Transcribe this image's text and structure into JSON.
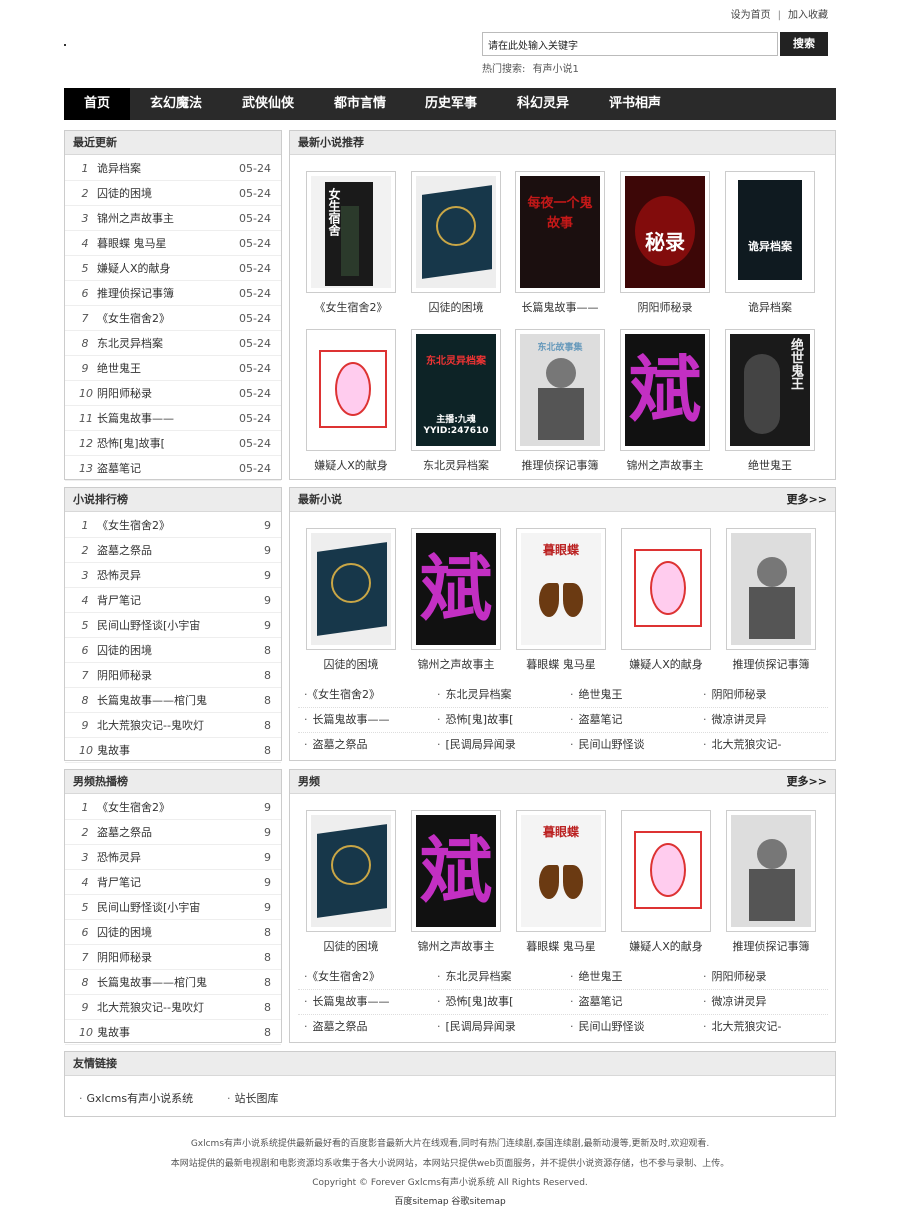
{
  "top_links": {
    "set_home": "设为首页",
    "separator": "|",
    "favorite": "加入收藏"
  },
  "search": {
    "value": "请在此处输入关键字",
    "button": "搜索",
    "hot_label": "热门搜索:",
    "hot_term": "有声小说1"
  },
  "nav": [
    "首页",
    "玄幻魔法",
    "武侠仙侠",
    "都市言情",
    "历史军事",
    "科幻灵异",
    "评书相声"
  ],
  "recent": {
    "title": "最近更新",
    "items": [
      {
        "n": "1",
        "t": "诡异档案",
        "d": "05-24"
      },
      {
        "n": "2",
        "t": "囚徒的困境",
        "d": "05-24"
      },
      {
        "n": "3",
        "t": "锦州之声故事主",
        "d": "05-24"
      },
      {
        "n": "4",
        "t": "暮眼蝶 鬼马星",
        "d": "05-24"
      },
      {
        "n": "5",
        "t": "嫌疑人X的献身",
        "d": "05-24"
      },
      {
        "n": "6",
        "t": "推理侦探记事簿",
        "d": "05-24"
      },
      {
        "n": "7",
        "t": "《女生宿舍2》",
        "d": "05-24"
      },
      {
        "n": "8",
        "t": "东北灵异档案",
        "d": "05-24"
      },
      {
        "n": "9",
        "t": "绝世鬼王",
        "d": "05-24"
      },
      {
        "n": "10",
        "t": "阴阳师秘录",
        "d": "05-24"
      },
      {
        "n": "11",
        "t": "长篇鬼故事——",
        "d": "05-24"
      },
      {
        "n": "12",
        "t": "恐怖[鬼]故事[",
        "d": "05-24"
      },
      {
        "n": "13",
        "t": "盗墓笔记",
        "d": "05-24"
      }
    ]
  },
  "rank": {
    "title": "小说排行榜",
    "items": [
      {
        "n": "1",
        "t": "《女生宿舍2》",
        "s": "9"
      },
      {
        "n": "2",
        "t": "盗墓之祭品",
        "s": "9"
      },
      {
        "n": "3",
        "t": "恐怖灵异",
        "s": "9"
      },
      {
        "n": "4",
        "t": "背尸笔记",
        "s": "9"
      },
      {
        "n": "5",
        "t": "民间山野怪谈[小宇宙",
        "s": "9"
      },
      {
        "n": "6",
        "t": "囚徒的困境",
        "s": "8"
      },
      {
        "n": "7",
        "t": "阴阳师秘录",
        "s": "8"
      },
      {
        "n": "8",
        "t": "长篇鬼故事——棺门鬼",
        "s": "8"
      },
      {
        "n": "9",
        "t": "北大荒狼灾记--鬼吹灯",
        "s": "8"
      },
      {
        "n": "10",
        "t": "鬼故事",
        "s": "8"
      }
    ]
  },
  "male_rank": {
    "title": "男频热播榜",
    "items": [
      {
        "n": "1",
        "t": "《女生宿舍2》",
        "s": "9"
      },
      {
        "n": "2",
        "t": "盗墓之祭品",
        "s": "9"
      },
      {
        "n": "3",
        "t": "恐怖灵异",
        "s": "9"
      },
      {
        "n": "4",
        "t": "背尸笔记",
        "s": "9"
      },
      {
        "n": "5",
        "t": "民间山野怪谈[小宇宙",
        "s": "9"
      },
      {
        "n": "6",
        "t": "囚徒的困境",
        "s": "8"
      },
      {
        "n": "7",
        "t": "阴阳师秘录",
        "s": "8"
      },
      {
        "n": "8",
        "t": "长篇鬼故事——棺门鬼",
        "s": "8"
      },
      {
        "n": "9",
        "t": "北大荒狼灾记--鬼吹灯",
        "s": "8"
      },
      {
        "n": "10",
        "t": "鬼故事",
        "s": "8"
      }
    ]
  },
  "recommend": {
    "title": "最新小说推荐",
    "books": [
      "《女生宿舍2》",
      "囚徒的困境",
      "长篇鬼故事——",
      "阴阳师秘录",
      "诡异档案",
      "嫌疑人X的献身",
      "东北灵异档案",
      "推理侦探记事簿",
      "锦州之声故事主",
      "绝世鬼王"
    ],
    "cover_text": {
      "b1": "女生宿舍",
      "b3": "每夜一个鬼故事",
      "b4": "秘录",
      "b5": "诡异档案",
      "b7_top": "东北灵异档案",
      "b7_bot": "主播:九魂",
      "b7_id": "YYID:247610",
      "b9": "斌",
      "b10": "绝世鬼王",
      "b8": "东北故事集"
    }
  },
  "latest": {
    "title": "最新小说",
    "more": "更多>>",
    "books": [
      "囚徒的困境",
      "锦州之声故事主",
      "暮眼蝶 鬼马星",
      "嫌疑人X的献身",
      "推理侦探记事簿"
    ],
    "cover_text": {
      "b3": "暮眼蝶"
    },
    "links": [
      [
        "《女生宿舍2》",
        "东北灵异档案",
        "绝世鬼王",
        "阴阳师秘录"
      ],
      [
        "长篇鬼故事——",
        "恐怖[鬼]故事[",
        "盗墓笔记",
        "微凉讲灵异"
      ],
      [
        "盗墓之祭品",
        "[民调局异闻录",
        "民间山野怪谈",
        "北大荒狼灾记-"
      ]
    ]
  },
  "male": {
    "title": "男频",
    "more": "更多>>",
    "books": [
      "囚徒的困境",
      "锦州之声故事主",
      "暮眼蝶 鬼马星",
      "嫌疑人X的献身",
      "推理侦探记事簿"
    ],
    "links": [
      [
        "《女生宿舍2》",
        "东北灵异档案",
        "绝世鬼王",
        "阴阳师秘录"
      ],
      [
        "长篇鬼故事——",
        "恐怖[鬼]故事[",
        "盗墓笔记",
        "微凉讲灵异"
      ],
      [
        "盗墓之祭品",
        "[民调局异闻录",
        "民间山野怪谈",
        "北大荒狼灾记-"
      ]
    ]
  },
  "friends": {
    "title": "友情链接",
    "links": [
      "Gxlcms有声小说系统",
      "站长图库"
    ]
  },
  "footer": {
    "line1": "Gxlcms有声小说系统提供最新最好看的百度影音最新大片在线观看,同时有热门连续剧,泰国连续剧,最新动漫等,更新及时,欢迎观看.",
    "line2": "本网站提供的最新电视剧和电影资源均系收集于各大小说网站，本网站只提供web页面服务，并不提供小说资源存储，也不参与录制、上传。",
    "line3": "Copyright © Forever Gxlcms有声小说系统 All Rights Reserved.",
    "line4": "百度sitemap 谷歌sitemap"
  }
}
